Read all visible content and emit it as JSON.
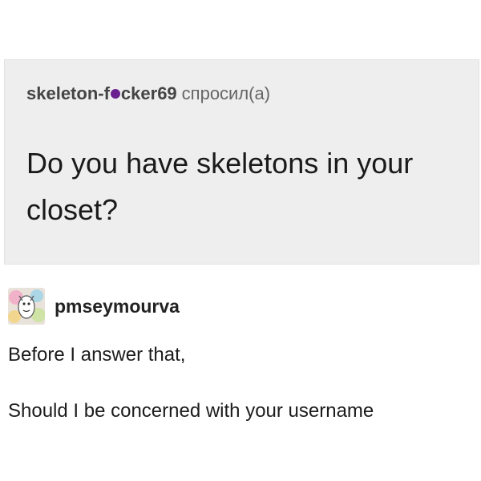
{
  "ask": {
    "asker_name_prefix": "skeleton-f",
    "asker_name_suffix": "cker69",
    "asked_verb": "спросил(а)",
    "question": "Do you have skeletons in your closet?",
    "censor_dot_color": "#6b1f8f"
  },
  "answer": {
    "username": "pmseymourva",
    "avatar_icon": "illustrated-avatar-icon",
    "paragraphs": [
      "Before I answer that,",
      "Should I be concerned with your username"
    ]
  },
  "colors": {
    "ask_background": "#eeeeee",
    "text": "#1c1c1c"
  }
}
